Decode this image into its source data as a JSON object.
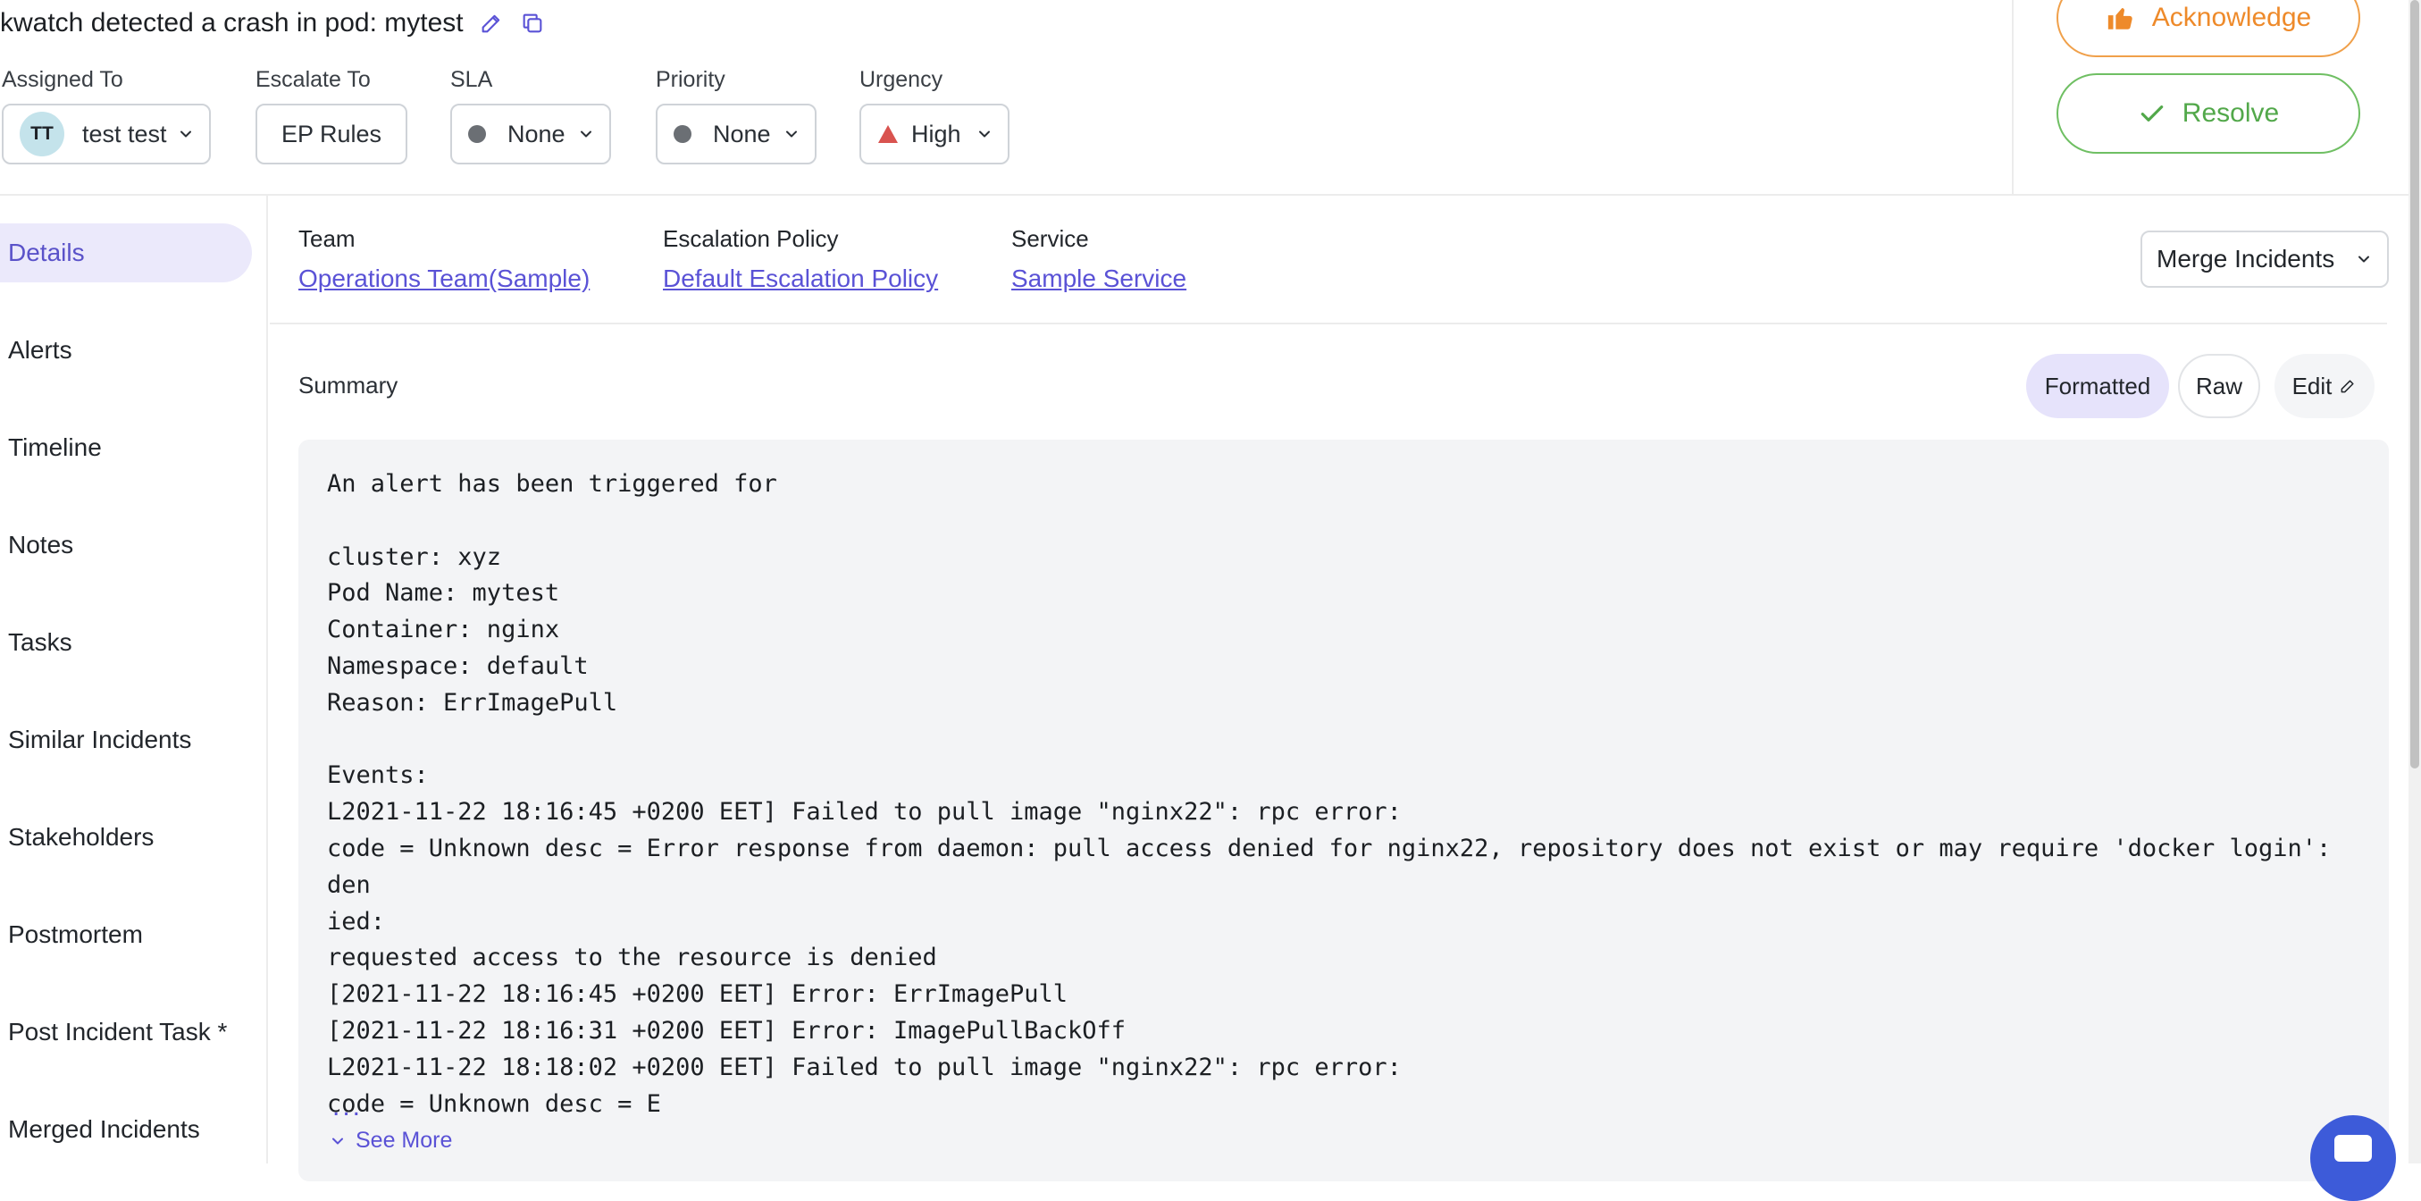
{
  "incident": {
    "title": "kwatch detected a crash in pod: mytest"
  },
  "fields": {
    "assigned_to": {
      "label": "Assigned To",
      "avatar_initials": "TT",
      "value": "test test"
    },
    "escalate_to": {
      "label": "Escalate To",
      "value": "EP Rules"
    },
    "sla": {
      "label": "SLA",
      "value": "None"
    },
    "priority": {
      "label": "Priority",
      "value": "None"
    },
    "urgency": {
      "label": "Urgency",
      "value": "High",
      "color": "#d9534f"
    }
  },
  "actions": {
    "acknowledge": "Acknowledge",
    "resolve": "Resolve"
  },
  "sidebar": {
    "items": [
      {
        "label": "Details"
      },
      {
        "label": "Alerts"
      },
      {
        "label": "Timeline"
      },
      {
        "label": "Notes"
      },
      {
        "label": "Tasks"
      },
      {
        "label": "Similar Incidents"
      },
      {
        "label": "Stakeholders"
      },
      {
        "label": "Postmortem"
      },
      {
        "label": "Post Incident Task *"
      },
      {
        "label": "Merged Incidents"
      }
    ]
  },
  "meta": {
    "team": {
      "label": "Team",
      "value": "Operations Team(Sample)"
    },
    "escalation_policy": {
      "label": "Escalation Policy",
      "value": "Default Escalation Policy"
    },
    "service": {
      "label": "Service",
      "value": "Sample Service"
    },
    "merge_label": "Merge Incidents"
  },
  "summary": {
    "label": "Summary",
    "view_modes": {
      "formatted": "Formatted",
      "raw": "Raw",
      "edit": "Edit"
    },
    "body": "An alert has been triggered for\n\ncluster: xyz\nPod Name: mytest\nContainer: nginx\nNamespace: default\nReason: ErrImagePull\n\nEvents:\nL2021-11-22 18:16:45 +0200 EET] Failed to pull image \"nginx22\": rpc error:\ncode = Unknown desc = Error response from daemon: pull access denied for nginx22, repository does not exist or may require 'docker login': den\nied:\nrequested access to the resource is denied\n[2021-11-22 18:16:45 +0200 EET] Error: ErrImagePull\n[2021-11-22 18:16:31 +0200 EET] Error: ImagePullBackOff\nL2021-11-22 18:18:02 +0200 EET] Failed to pull image \"nginx22\": rpc error:\ncode = Unknown desc = E",
    "ellipsis": "...",
    "see_more": "See More"
  },
  "colors": {
    "accent": "#5a52d6",
    "acknowledge": "#ee8a2a",
    "resolve": "#52a84a"
  }
}
